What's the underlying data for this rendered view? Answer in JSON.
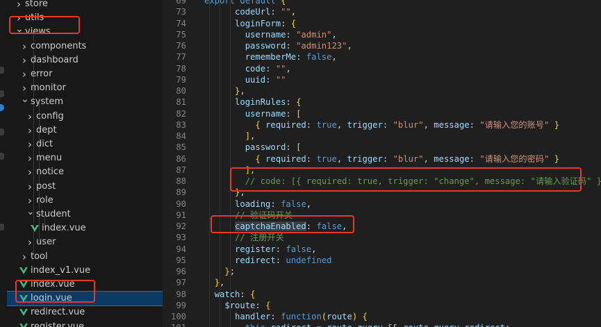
{
  "explorer": {
    "items": [
      {
        "label": "store",
        "type": "folder",
        "expanded": false
      },
      {
        "label": "utils",
        "type": "folder",
        "expanded": false
      },
      {
        "label": "views",
        "type": "folder",
        "expanded": true
      },
      {
        "label": "components",
        "type": "folder",
        "expanded": false
      },
      {
        "label": "dashboard",
        "type": "folder",
        "expanded": false
      },
      {
        "label": "error",
        "type": "folder",
        "expanded": false
      },
      {
        "label": "monitor",
        "type": "folder",
        "expanded": false
      },
      {
        "label": "system",
        "type": "folder",
        "expanded": true
      },
      {
        "label": "config",
        "type": "folder",
        "expanded": false
      },
      {
        "label": "dept",
        "type": "folder",
        "expanded": false
      },
      {
        "label": "dict",
        "type": "folder",
        "expanded": false
      },
      {
        "label": "menu",
        "type": "folder",
        "expanded": false
      },
      {
        "label": "notice",
        "type": "folder",
        "expanded": false
      },
      {
        "label": "post",
        "type": "folder",
        "expanded": false
      },
      {
        "label": "role",
        "type": "folder",
        "expanded": false
      },
      {
        "label": "student",
        "type": "folder",
        "expanded": true
      },
      {
        "label": "index.vue",
        "type": "vue-file"
      },
      {
        "label": "user",
        "type": "folder",
        "expanded": false
      },
      {
        "label": "tool",
        "type": "folder",
        "expanded": false
      },
      {
        "label": "index_v1.vue",
        "type": "vue-file"
      },
      {
        "label": "index.vue",
        "type": "vue-file"
      },
      {
        "label": "login.vue",
        "type": "vue-file",
        "selected": true
      },
      {
        "label": "redirect.vue",
        "type": "vue-file"
      },
      {
        "label": "register.vue",
        "type": "vue-file"
      }
    ]
  },
  "editor": {
    "lines": [
      {
        "n": "69",
        "text": "export default {"
      },
      {
        "n": "73",
        "text": "      codeUrl: \"\","
      },
      {
        "n": "74",
        "text": "      loginForm: {"
      },
      {
        "n": "75",
        "text": "        username: \"admin\","
      },
      {
        "n": "76",
        "text": "        password: \"admin123\","
      },
      {
        "n": "77",
        "text": "        rememberMe: false,"
      },
      {
        "n": "78",
        "text": "        code: \"\","
      },
      {
        "n": "79",
        "text": "        uuid: \"\""
      },
      {
        "n": "80",
        "text": "      },"
      },
      {
        "n": "81",
        "text": "      loginRules: {"
      },
      {
        "n": "82",
        "text": "        username: ["
      },
      {
        "n": "83",
        "text": "          { required: true, trigger: \"blur\", message: \"请输入您的账号\" }"
      },
      {
        "n": "84",
        "text": "        ],"
      },
      {
        "n": "85",
        "text": "        password: ["
      },
      {
        "n": "86",
        "text": "          { required: true, trigger: \"blur\", message: \"请输入您的密码\" }"
      },
      {
        "n": "87",
        "text": "        ],"
      },
      {
        "n": "88",
        "text": "        // code: [{ required: true, trigger: \"change\", message: \"请输入验证码\" }]"
      },
      {
        "n": "89",
        "text": "      },"
      },
      {
        "n": "90",
        "text": "      loading: false,"
      },
      {
        "n": "91",
        "text": "      // 验证码开关"
      },
      {
        "n": "92",
        "text": "      captchaEnabled: false,"
      },
      {
        "n": "93",
        "text": "      // 注册开关"
      },
      {
        "n": "94",
        "text": "      register: false,"
      },
      {
        "n": "95",
        "text": "      redirect: undefined"
      },
      {
        "n": "96",
        "text": "    };"
      },
      {
        "n": "97",
        "text": "  },"
      },
      {
        "n": "98",
        "text": "  watch: {"
      },
      {
        "n": "99",
        "text": "    $route: {"
      },
      {
        "n": "100",
        "text": "      handler: function(route) {"
      },
      {
        "n": "101",
        "text": "        this.redirect = route.query && route.query.redirect;"
      }
    ]
  },
  "colors": {
    "annotation": "#e8382e",
    "selection": "#0a3a66",
    "vue_icon": "#41b883"
  }
}
